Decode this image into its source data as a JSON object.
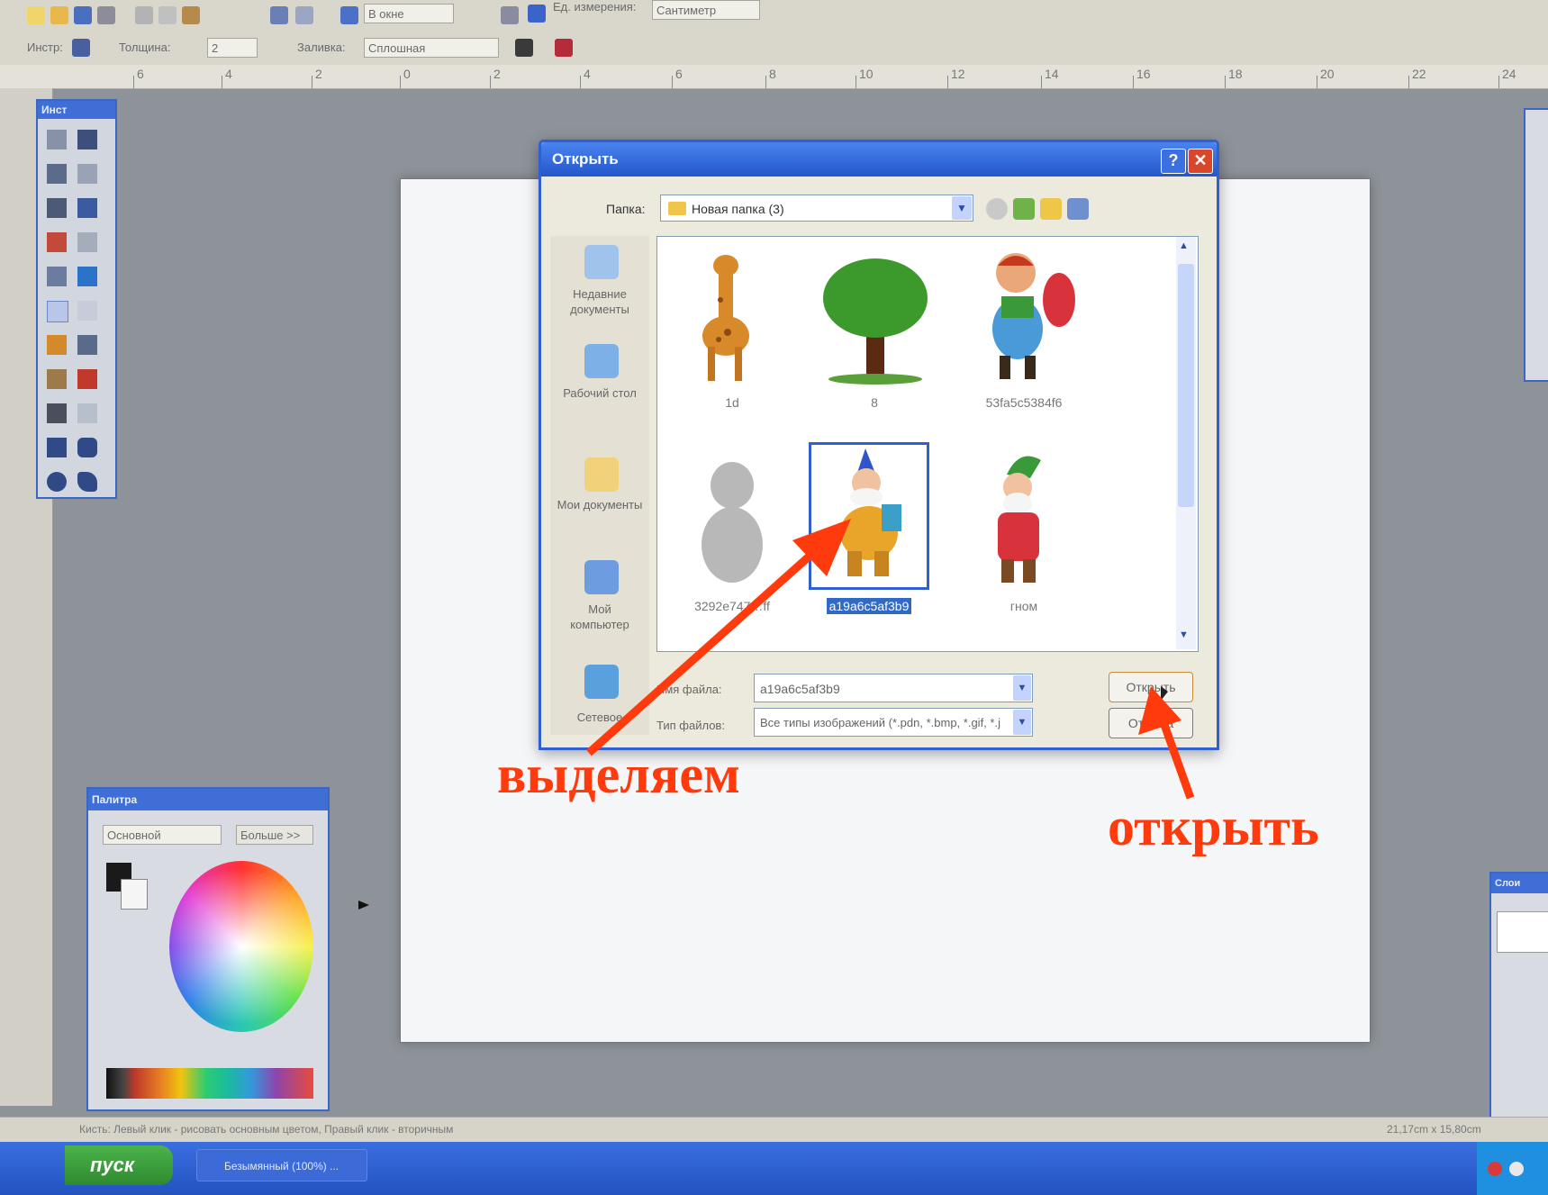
{
  "toolbar": {
    "zoom_value": "В окне",
    "units_label": "Ед. измерения:",
    "units_value": "Сантиметр",
    "tool_label": "Инстр:",
    "width_label": "Толщина:",
    "width_value": "2",
    "fill_label": "Заливка:",
    "fill_value": "Сплошная"
  },
  "ruler": {
    "marks": [
      "6",
      "4",
      "2",
      "0",
      "2",
      "4",
      "6",
      "8",
      "10",
      "12",
      "14",
      "16",
      "18",
      "20",
      "22",
      "24"
    ]
  },
  "tools_window": {
    "title": "Инст"
  },
  "palette_window": {
    "title": "Палитра",
    "mode_value": "Основной",
    "more_button": "Больше >>"
  },
  "layers_window": {
    "title": "Слои"
  },
  "open_dialog": {
    "title": "Открыть",
    "help_button": "?",
    "close_button": "✕",
    "look_in_label": "Папка:",
    "look_in_value": "Новая папка (3)",
    "places": [
      {
        "label": "Недавние документы"
      },
      {
        "label": "Рабочий стол"
      },
      {
        "label": "Мои документы"
      },
      {
        "label": "Мой компьютер"
      },
      {
        "label": "Сетевое"
      }
    ],
    "files": [
      {
        "name": "1d"
      },
      {
        "name": "8"
      },
      {
        "name": "53fa5c5384f6"
      },
      {
        "name": "3292e747…ff"
      },
      {
        "name": "a19a6c5af3b9"
      },
      {
        "name": "гном"
      }
    ],
    "file_name_label": "Имя файла:",
    "file_name_value": "a19a6c5af3b9",
    "file_type_label": "Тип файлов:",
    "file_type_value": "Все типы изображений (*.pdn, *.bmp, *.gif, *.j",
    "open_button": "Открыть",
    "cancel_button": "Отмена"
  },
  "annotations": {
    "select_text": "выделяем",
    "open_text": "открыть",
    "color": "#ff3a0c"
  },
  "statusbar": {
    "hint": "Кисть: Левый клик - рисовать основным цветом, Правый клик - вторичным",
    "coords": "21,17cm x 15,80cm"
  },
  "taskbar": {
    "start_label": "пуск",
    "task_item": "Безымянный (100%) ..."
  }
}
